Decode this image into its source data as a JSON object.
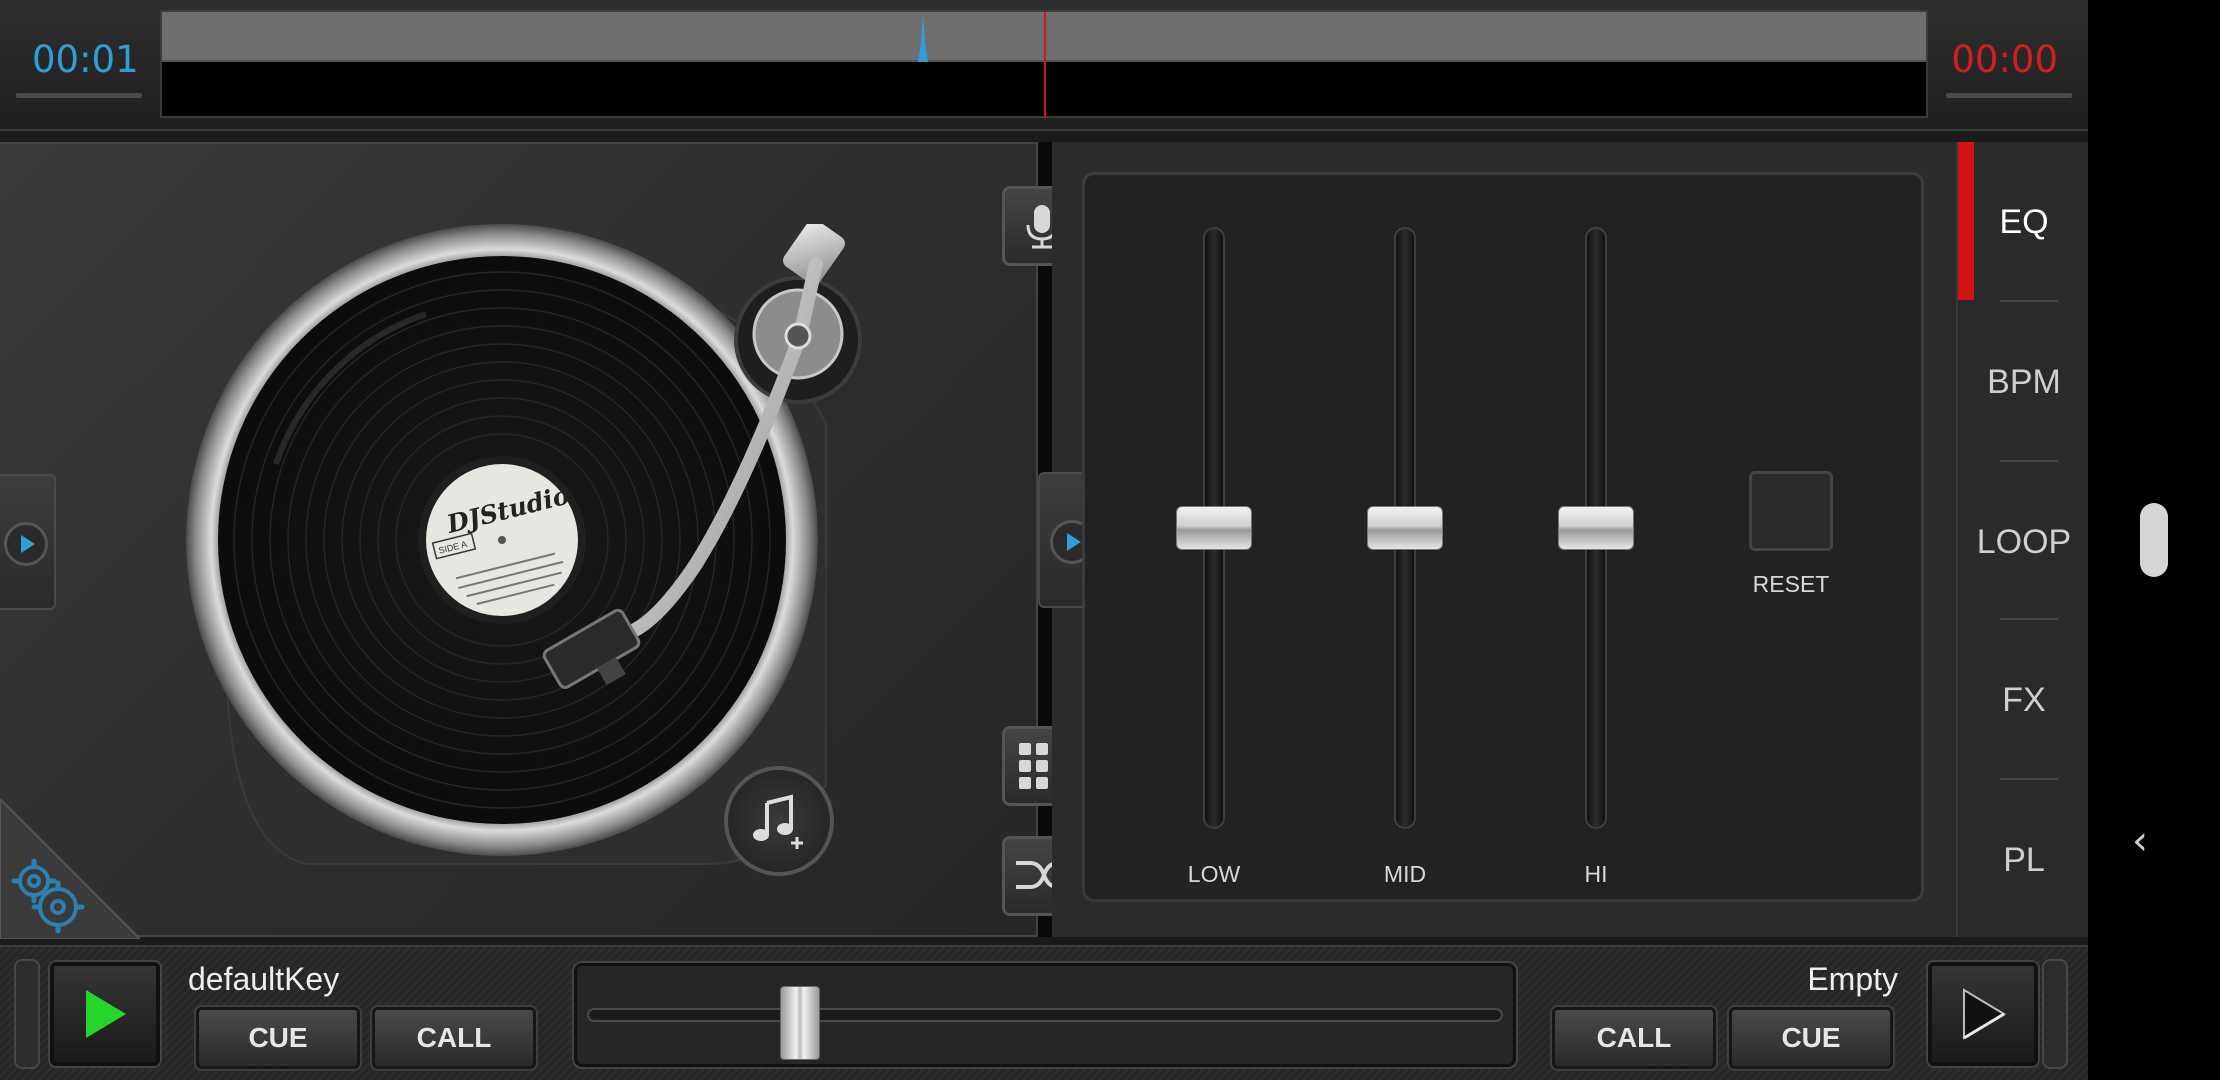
{
  "topbar": {
    "time_left": "00:01",
    "time_right": "00:00",
    "time_left_color": "#2e9fd6",
    "time_right_color": "#cf1f1f"
  },
  "turntable": {
    "label_brand": "DJStudio",
    "label_side": "SIDE A"
  },
  "eq": {
    "bands": [
      {
        "label": "LOW",
        "level": 0.5
      },
      {
        "label": "MID",
        "level": 0.5
      },
      {
        "label": "HI",
        "level": 0.5
      }
    ],
    "reset_label": "RESET"
  },
  "tabs": [
    {
      "label": "EQ",
      "active": true
    },
    {
      "label": "BPM",
      "active": false
    },
    {
      "label": "LOOP",
      "active": false
    },
    {
      "label": "FX",
      "active": false
    },
    {
      "label": "PL",
      "active": false
    }
  ],
  "deck_a": {
    "name": "defaultKey",
    "cue_label": "CUE",
    "call_label": "CALL",
    "play_icon": "play-icon",
    "play_color": "#27d62a"
  },
  "deck_b": {
    "name": "Empty",
    "cue_label": "CUE",
    "call_label": "CALL",
    "play_icon": "play-icon"
  },
  "crossfader": {
    "position": 0.22
  },
  "icons": {
    "mic": "microphone-icon",
    "grid": "grid-icon",
    "shuffle": "shuffle-icon",
    "music_add": "music-add-icon",
    "settings": "settings-icon",
    "deck_expand": "play-circle-icon"
  },
  "accent_color": "#d01414"
}
